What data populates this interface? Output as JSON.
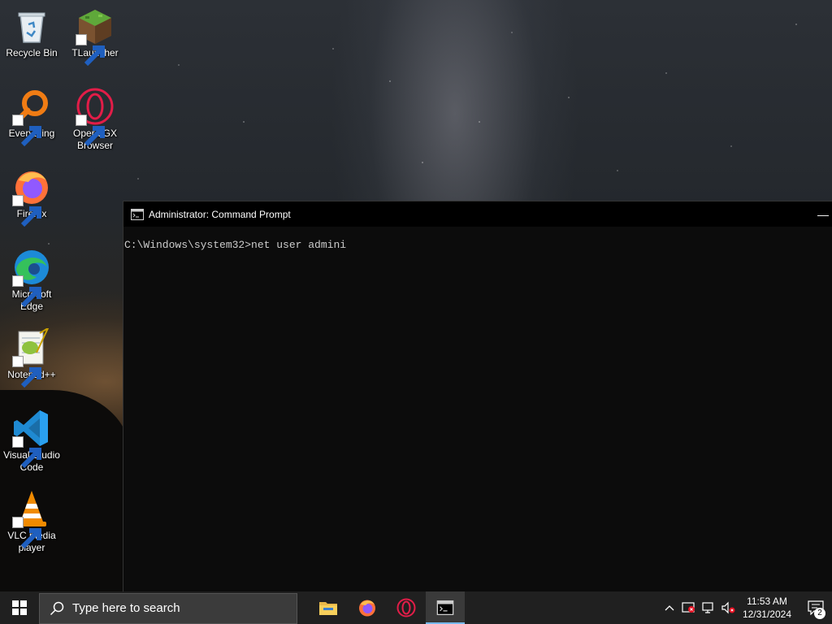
{
  "desktop": {
    "icons": [
      {
        "label": "Recycle Bin",
        "icon": "recycle-bin-icon"
      },
      {
        "label": "TLauncher",
        "icon": "tlauncher-icon"
      },
      {
        "label": "Everything",
        "icon": "everything-search-icon"
      },
      {
        "label": "Opera GX Browser",
        "icon": "opera-gx-icon"
      },
      {
        "label": "Firefox",
        "icon": "firefox-icon"
      },
      {
        "label": "Microsoft Edge",
        "icon": "edge-icon"
      },
      {
        "label": "Notepad++",
        "icon": "notepadpp-icon"
      },
      {
        "label": "Visual Studio Code",
        "icon": "vscode-icon"
      },
      {
        "label": "VLC media player",
        "icon": "vlc-icon"
      }
    ]
  },
  "cmd_window": {
    "title": "Administrator: Command Prompt",
    "prompt_line": "C:\\Windows\\system32>net user admini",
    "minimize_symbol": "—"
  },
  "taskbar": {
    "search_placeholder": "Type here to search",
    "apps": [
      {
        "name": "File Explorer",
        "icon": "folder-icon"
      },
      {
        "name": "Firefox",
        "icon": "firefox-icon"
      },
      {
        "name": "Opera GX",
        "icon": "opera-gx-icon"
      },
      {
        "name": "Command Prompt",
        "icon": "cmd-icon",
        "active": true
      }
    ],
    "tray": {
      "time": "11:53 AM",
      "date": "12/31/2024",
      "notification_count": "2"
    }
  },
  "colors": {
    "taskbar_bg": "#202020",
    "console_bg": "#0c0c0c",
    "console_text": "#cccccc",
    "accent": "#76b9ed"
  }
}
